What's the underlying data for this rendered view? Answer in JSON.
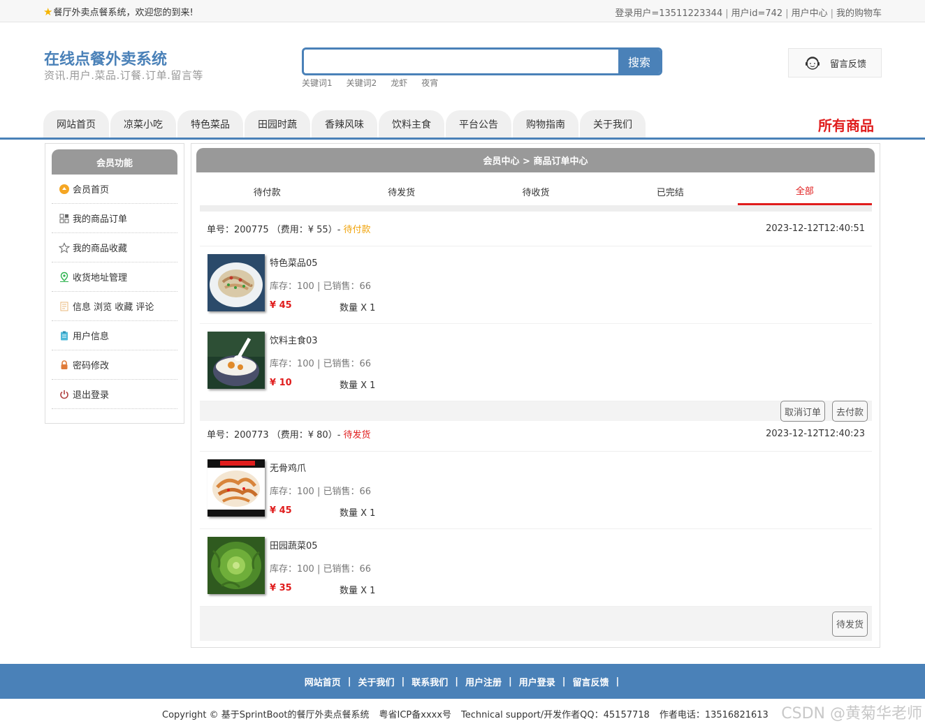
{
  "topbar": {
    "welcome": "餐厅外卖点餐系统，欢迎您的到来!",
    "login_user": "登录用户=13511223344",
    "user_id": "用户id=742",
    "user_center": "用户中心",
    "cart": "我的购物车"
  },
  "header": {
    "title": "在线点餐外卖系统",
    "subtitle": "资讯.用户.菜品.订餐.订单.留言等",
    "search_button": "搜索",
    "search_value": "",
    "keywords": [
      "关键词1",
      "关键词2",
      "龙虾",
      "夜宵"
    ],
    "feedback": "留言反馈"
  },
  "nav": {
    "items": [
      "网站首页",
      "凉菜小吃",
      "特色菜品",
      "田园时蔬",
      "香辣风味",
      "饮料主食",
      "平台公告",
      "购物指南",
      "关于我们"
    ],
    "all_goods": "所有商品"
  },
  "sidebar": {
    "title": "会员功能",
    "items": [
      "会员首页",
      "我的商品订单",
      "我的商品收藏",
      "收货地址管理",
      "信息 浏览 收藏 评论",
      "用户信息",
      "密码修改",
      "退出登录"
    ]
  },
  "main": {
    "breadcrumb": "会员中心 > 商品订单中心",
    "tabs": [
      "待付款",
      "待发货",
      "待收货",
      "已完结",
      "全部"
    ],
    "active_tab": "全部",
    "orders": [
      {
        "number_label": "单号：200775 （费用：¥ 55）- ",
        "status": "待付款",
        "time": "2023-12-12T12:40:51",
        "goods": [
          {
            "name": "特色菜品05",
            "stock": "库存：100 | 已销售：66",
            "price": "¥ 45",
            "qty": "数量 X 1"
          },
          {
            "name": "饮料主食03",
            "stock": "库存：100 | 已销售：66",
            "price": "¥ 10",
            "qty": "数量 X 1"
          }
        ],
        "buttons": [
          "取消订单",
          "去付款"
        ]
      },
      {
        "number_label": "单号：200773 （费用：¥ 80）- ",
        "status": "待发货",
        "time": "2023-12-12T12:40:23",
        "goods": [
          {
            "name": "无骨鸡爪",
            "stock": "库存：100 | 已销售：66",
            "price": "¥ 45",
            "qty": "数量 X 1"
          },
          {
            "name": "田园蔬菜05",
            "stock": "库存：100 | 已销售：66",
            "price": "¥ 35",
            "qty": "数量 X 1"
          }
        ],
        "buttons": [
          "待发货"
        ]
      }
    ]
  },
  "footer": {
    "links": [
      "网站首页",
      "关于我们",
      "联系我们",
      "用户注册",
      "用户登录",
      "留言反馈"
    ],
    "copyright": "Copyright © 基于SprintBoot的餐厅外卖点餐系统",
    "icp": "粤省ICP备xxxx号",
    "support": "Technical support/开发作者QQ：45157718",
    "phone": "作者电话：13516821613",
    "watermark": "CSDN @黄菊华老师"
  }
}
